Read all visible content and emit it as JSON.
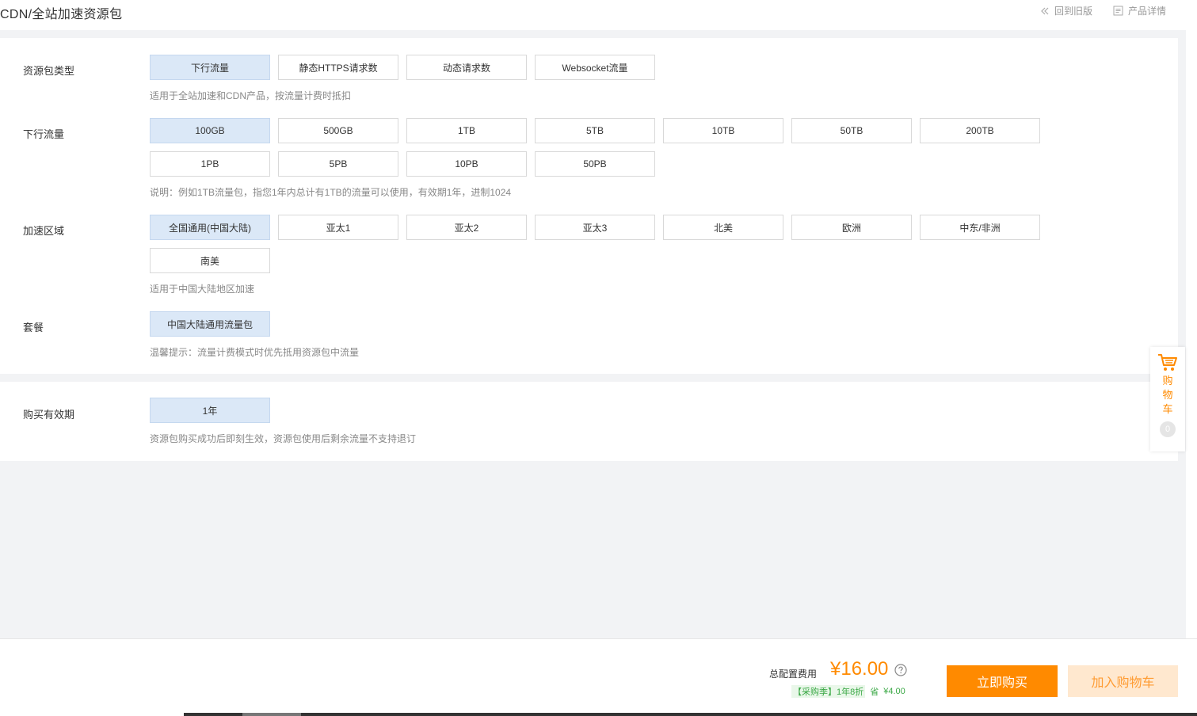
{
  "header": {
    "title": "CDN/全站加速资源包",
    "back_old": "回到旧版",
    "product_detail": "产品详情"
  },
  "pkg_type": {
    "label": "资源包类型",
    "options": [
      "下行流量",
      "静态HTTPS请求数",
      "动态请求数",
      "Websocket流量"
    ],
    "selected": "下行流量",
    "hint": "适用于全站加速和CDN产品，按流量计费时抵扣"
  },
  "traffic": {
    "label": "下行流量",
    "options": [
      "100GB",
      "500GB",
      "1TB",
      "5TB",
      "10TB",
      "50TB",
      "200TB",
      "1PB",
      "5PB",
      "10PB",
      "50PB"
    ],
    "selected": "100GB",
    "hint": "说明：例如1TB流量包，指您1年内总计有1TB的流量可以使用，有效期1年，进制1024"
  },
  "region": {
    "label": "加速区域",
    "options": [
      "全国通用(中国大陆)",
      "亚太1",
      "亚太2",
      "亚太3",
      "北美",
      "欧洲",
      "中东/非洲",
      "南美"
    ],
    "selected": "全国通用(中国大陆)",
    "hint": "适用于中国大陆地区加速"
  },
  "plan": {
    "label": "套餐",
    "options": [
      "中国大陆通用流量包"
    ],
    "selected": "中国大陆通用流量包",
    "hint": "温馨提示：流量计费模式时优先抵用资源包中流量"
  },
  "duration": {
    "label": "购买有效期",
    "options": [
      "1年"
    ],
    "selected": "1年",
    "hint": "资源包购买成功后即刻生效，资源包使用后剩余流量不支持退订"
  },
  "cart_tab": {
    "text": "购物车",
    "count": "0"
  },
  "footer": {
    "total_label": "总配置费用",
    "price": "¥16.00",
    "promo_tag": "【采购季】1年8折",
    "promo_save": "省",
    "promo_save_amount": "¥4.00",
    "buy_now": "立即购买",
    "add_to_cart": "加入购物车"
  },
  "colors": {
    "accent": "#ff8a00",
    "selected_bg": "#dbe8f7",
    "promo_green": "#3aa845"
  }
}
